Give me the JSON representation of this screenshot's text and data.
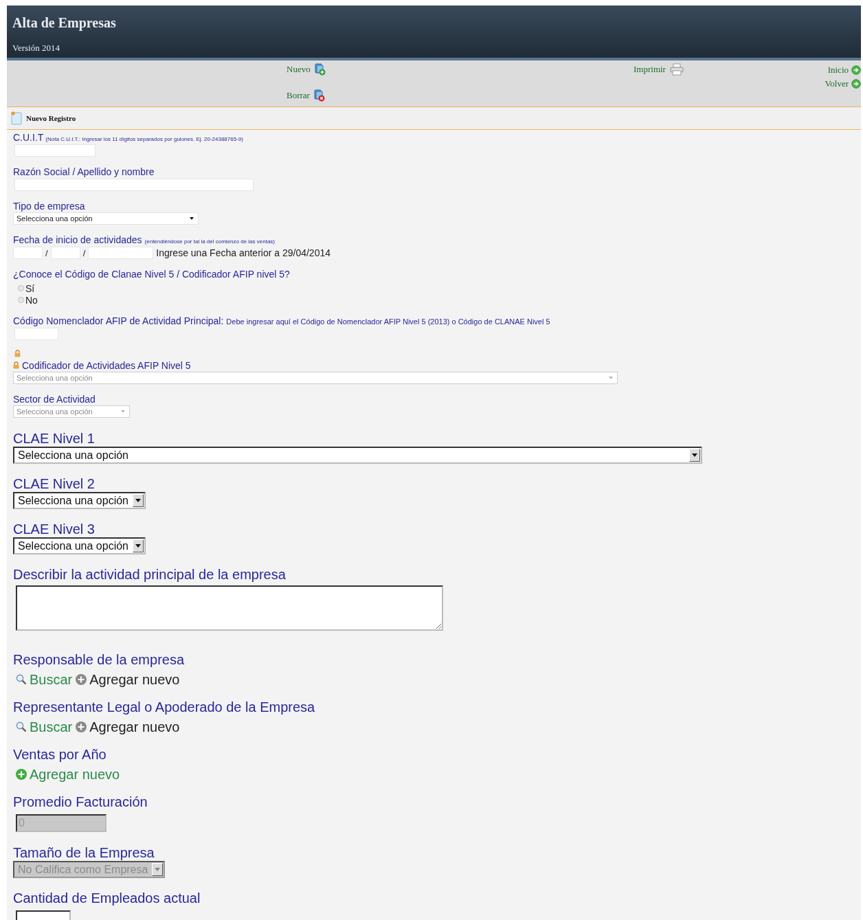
{
  "header": {
    "title": "Alta de Empresas",
    "version": "Versión 2014"
  },
  "toolbar": [
    {
      "items": [
        {
          "label": "Nuevo",
          "kind": "add"
        },
        {
          "label": "Borrar",
          "kind": "delete"
        }
      ]
    },
    {
      "items": [
        {
          "label": "Imprimir",
          "kind": "print"
        }
      ]
    },
    {
      "items": [
        {
          "label": "Inicio",
          "kind": "go"
        },
        {
          "label": "Volver",
          "kind": "go"
        }
      ]
    }
  ],
  "section": {
    "title": "Nuevo Registro"
  },
  "fields": [
    {
      "kind": "text-short",
      "label": "C.U.I.T",
      "note": "(Nota C.U.I.T.: Ingresar los 11 dígitos separados por guiones. Ej. 20-24388765-9)",
      "disabled": false
    },
    {
      "kind": "text-wide",
      "label": "Razón Social / Apellido y nombre",
      "disabled": false
    },
    {
      "kind": "select",
      "label": "Tipo de empresa",
      "value": "Selecciona una opción",
      "disabled": false
    },
    {
      "kind": "date",
      "label": "Fecha de inicio de actividades",
      "note": "(entendiéndose por tal la del comienzo de las ventas)",
      "separators": [
        "/",
        "/"
      ],
      "hint": "Ingrese una Fecha anterior a 29/04/2014"
    },
    {
      "kind": "radio",
      "label": "¿Conoce el Código de Clanae Nivel 5 / Codificador AFIP nivel 5?",
      "options": [
        {
          "label": "Sí",
          "selected": false
        },
        {
          "label": "No",
          "selected": false
        }
      ]
    },
    {
      "kind": "text-short",
      "label": "Código Nomenclador AFIP de Actividad Principal:",
      "note": "Debe ingresar aquí el Código de Nomenclador AFIP Nivel 5 (2013) o Código de CLANAE Nivel 5",
      "disabled": false
    },
    {
      "kind": "select-wide",
      "label": "Codificador de Actividades AFIP Nivel 5",
      "locked": true,
      "value": "Selecciona una opción",
      "disabled": true
    },
    {
      "kind": "select-narrow",
      "label": "Sector de Actividad",
      "value": "Selecciona una opción",
      "disabled": true
    },
    {
      "kind": "big-select-wide",
      "label": "CLAE Nivel 1",
      "value": "Selecciona una opción",
      "disabled": false
    },
    {
      "kind": "big-select",
      "label": "CLAE Nivel 2",
      "value": "Selecciona una opción",
      "disabled": false
    },
    {
      "kind": "big-select",
      "label": "CLAE Nivel 3",
      "value": "Selecciona una opción",
      "disabled": false
    },
    {
      "kind": "textarea",
      "label": "Describir la actividad principal de la empresa"
    },
    {
      "kind": "actions",
      "label": "Responsable de la empresa",
      "actions": [
        {
          "label": "Buscar",
          "kind": "search",
          "disabled": false
        },
        {
          "label": "Agregar nuevo",
          "kind": "add",
          "disabled": true
        }
      ]
    },
    {
      "kind": "actions",
      "label": "Representante Legal o Apoderado de la Empresa",
      "actions": [
        {
          "label": "Buscar",
          "kind": "search",
          "disabled": false
        },
        {
          "label": "Agregar nuevo",
          "kind": "add",
          "disabled": true
        }
      ]
    },
    {
      "kind": "actions",
      "label": "Ventas por Año",
      "actions": [
        {
          "label": "Agregar nuevo",
          "kind": "add",
          "disabled": false
        }
      ]
    },
    {
      "kind": "big-text",
      "label": "Promedio Facturación",
      "value": "0",
      "disabled": true
    },
    {
      "kind": "big-select",
      "label": "Tamaño de la Empresa",
      "value": "No Califica como Empresa",
      "disabled": true
    },
    {
      "kind": "big-text",
      "label": "Cantidad de Empleados actual",
      "disabled": false
    }
  ]
}
